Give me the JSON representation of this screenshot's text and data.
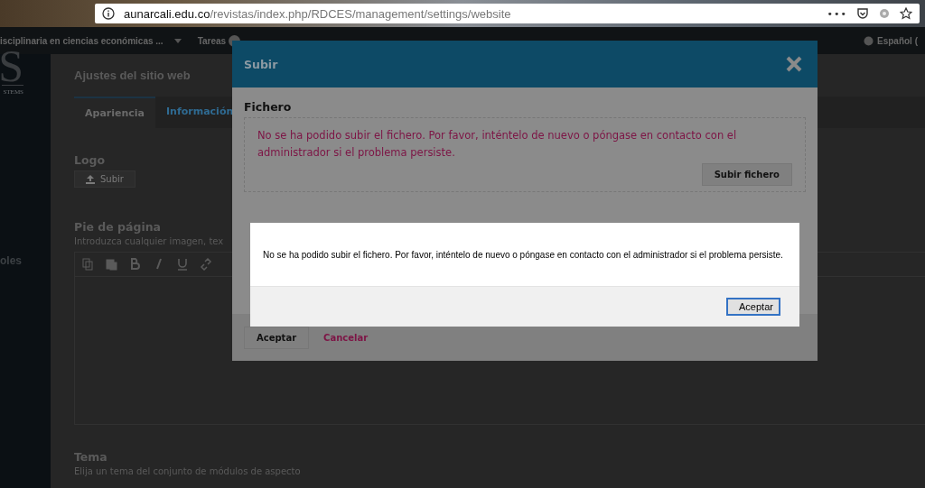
{
  "browser": {
    "url_host": "aunarcali.edu.co",
    "url_path": "/revistas/index.php/RDCES/management/settings/website",
    "menu": "•••"
  },
  "app_bar": {
    "context": "isciplinaria en ciencias económicas ...",
    "tasks": "Tareas",
    "language": "Español ("
  },
  "sidebar": {
    "logo_mark": "S",
    "logo_tagline": "STEMS",
    "items": [
      {
        "label": "oles",
        "selected": false
      }
    ]
  },
  "page": {
    "title": "Ajustes del sitio web",
    "tabs": [
      {
        "label": "Apariencia",
        "selected": true
      },
      {
        "label": "Información",
        "selected": false
      }
    ],
    "logo_label": "Logo",
    "upload_button": "Subir",
    "footer_label": "Pie de página",
    "footer_hint": "Introduzca cualquier imagen, tex",
    "theme_label": "Tema",
    "theme_hint": "Elija un tema del conjunto de módulos de aspecto"
  },
  "modal": {
    "title": "Subir",
    "section": "Fichero",
    "error": "No se ha podido subir el fichero. Por favor, inténtelo de nuevo o póngase en contacto con el administrador si el problema persiste.",
    "upload_button": "Subir fichero",
    "accept_button": "Aceptar",
    "cancel_link": "Cancelar"
  },
  "alert": {
    "message": "No se ha podido subir el fichero. Por favor, inténtelo de nuevo o póngase en contacto con el administrador si el problema persiste.",
    "button": "Aceptar"
  }
}
